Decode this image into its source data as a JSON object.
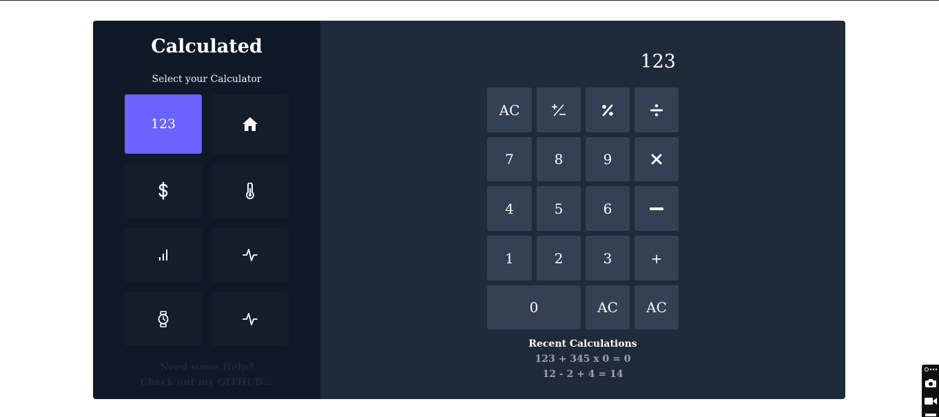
{
  "app": {
    "title": "Calculated",
    "subtitle": "Select your Calculator"
  },
  "sidebar": {
    "tiles": [
      {
        "label": "123",
        "icon": "numbers-label",
        "active": true
      },
      {
        "icon": "home-icon"
      },
      {
        "icon": "dollar-icon"
      },
      {
        "icon": "thermometer-icon"
      },
      {
        "icon": "bar-signal-icon"
      },
      {
        "icon": "pulse-icon"
      },
      {
        "icon": "watch-icon"
      },
      {
        "icon": "pulse-icon"
      }
    ],
    "help_line1": "Need some Help?",
    "help_line2": "Check out my GITHUB..."
  },
  "calculator": {
    "display": "123",
    "keys": {
      "ac": "AC",
      "plus_minus": "+/−",
      "percent": "%",
      "divide": "÷",
      "seven": "7",
      "eight": "8",
      "nine": "9",
      "multiply": "×",
      "four": "4",
      "five": "5",
      "six": "6",
      "minus": "−",
      "one": "1",
      "two": "2",
      "three": "3",
      "plus": "+",
      "zero": "0",
      "ac_2": "AC",
      "ac_3": "AC"
    }
  },
  "recent": {
    "title": "Recent Calculations",
    "items": [
      "123 + 345 x 0 = 0",
      "12 - 2 + 4 = 14"
    ]
  },
  "colors": {
    "accent": "#6c63ff",
    "sidebar_bg": "#111827",
    "tile_bg": "#161e2b",
    "panel_bg": "#1f2a3b",
    "key_bg": "#344154"
  }
}
